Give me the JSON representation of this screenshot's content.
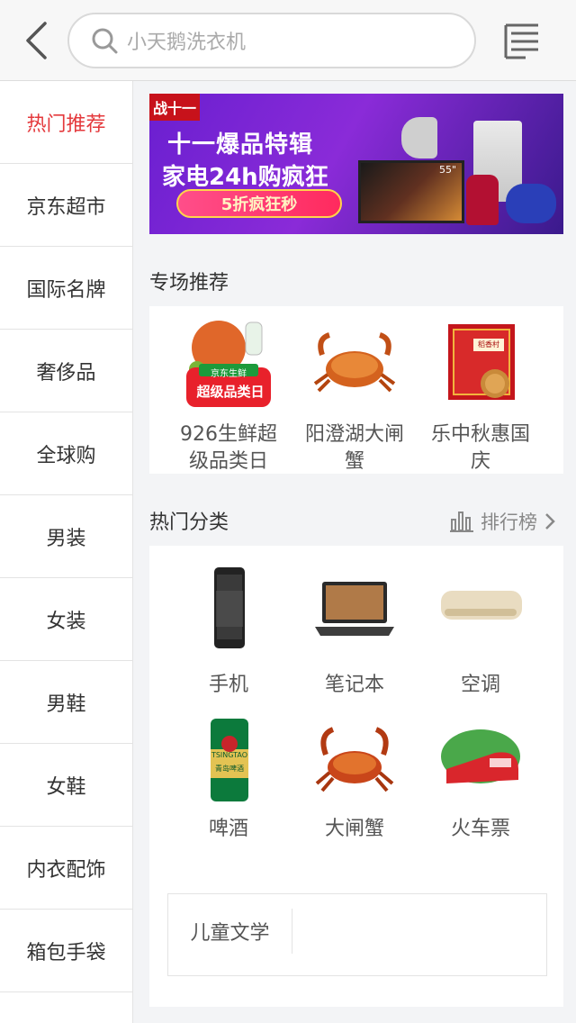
{
  "header": {
    "back_icon": "chevron-left-icon",
    "search_placeholder": "小天鹅洗衣机",
    "menu_icon": "list-icon"
  },
  "sidebar": {
    "items": [
      {
        "label": "热门推荐",
        "active": true
      },
      {
        "label": "京东超市"
      },
      {
        "label": "国际名牌"
      },
      {
        "label": "奢侈品"
      },
      {
        "label": "全球购"
      },
      {
        "label": "男装"
      },
      {
        "label": "女装"
      },
      {
        "label": "男鞋"
      },
      {
        "label": "女鞋"
      },
      {
        "label": "内衣配饰"
      },
      {
        "label": "箱包手袋"
      }
    ]
  },
  "banner": {
    "badge": "战十一",
    "title": "十一爆品特辑",
    "subtitle": "家电24h购疯狂",
    "button": "5折疯狂秒",
    "tv_size": "55\""
  },
  "special": {
    "title": "专场推荐",
    "items": [
      {
        "line1": "926生鲜超",
        "line2": "级品类日",
        "thumb_text": "京东生鲜",
        "thumb_text2": "超级品类日"
      },
      {
        "line1": "阳澄湖大闸",
        "line2": "蟹"
      },
      {
        "line1": "乐中秋惠国",
        "line2": "庆",
        "thumb_text": "稻香村"
      }
    ]
  },
  "hot": {
    "title": "热门分类",
    "rank_label": "排行榜",
    "items": [
      {
        "label": "手机",
        "icon": "phone-icon"
      },
      {
        "label": "笔记本",
        "icon": "laptop-icon"
      },
      {
        "label": "空调",
        "icon": "air-conditioner-icon"
      },
      {
        "label": "啤酒",
        "icon": "beer-can-icon",
        "can_text": "TSINGTAO",
        "can_text2": "青岛啤酒"
      },
      {
        "label": "大闸蟹",
        "icon": "crab-icon"
      },
      {
        "label": "火车票",
        "icon": "train-icon"
      }
    ]
  },
  "tags": {
    "items": [
      {
        "label": "儿童文学"
      }
    ]
  },
  "colors": {
    "accent": "#e4393c",
    "background": "#f3f4f6"
  }
}
